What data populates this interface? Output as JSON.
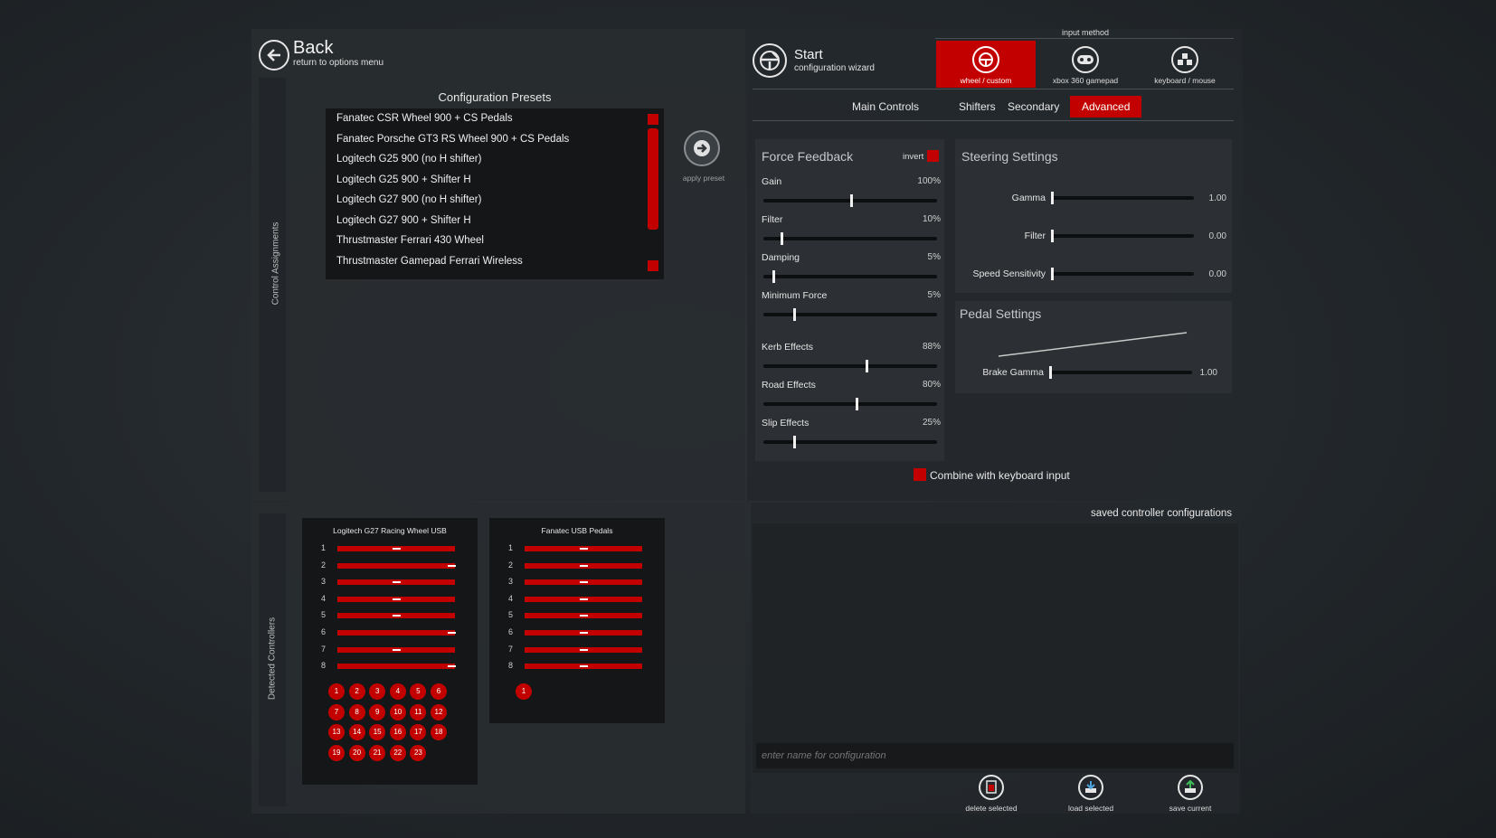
{
  "header": {
    "back_title": "Back",
    "back_subtitle": "return to options menu",
    "start_title": "Start",
    "start_subtitle": "configuration wizard"
  },
  "side_labels": {
    "control_assignments": "Control Assignments",
    "detected_controllers": "Detected Controllers"
  },
  "presets": {
    "title": "Configuration Presets",
    "apply_label": "apply preset",
    "items": [
      "Fanatec CSR Wheel 900 + CS Pedals",
      "Fanatec Porsche GT3 RS Wheel 900 + CS Pedals",
      "Logitech G25 900 (no H shifter)",
      "Logitech G25 900 + Shifter H",
      "Logitech G27 900 (no H shifter)",
      "Logitech G27 900 + Shifter H",
      "Thrustmaster Ferrari 430 Wheel",
      "Thrustmaster Gamepad Ferrari Wireless"
    ]
  },
  "input_method": {
    "title": "input method",
    "options": [
      "wheel / custom",
      "xbox 360 gamepad",
      "keyboard / mouse"
    ],
    "selected": "wheel / custom"
  },
  "tabs": [
    "Main Controls",
    "Shifters",
    "Secondary",
    "Advanced"
  ],
  "active_tab": "Advanced",
  "force_feedback": {
    "title": "Force Feedback",
    "invert_label": "invert",
    "sliders": [
      {
        "label": "Gain",
        "value": "100%",
        "level": 0.5
      },
      {
        "label": "Filter",
        "value": "10%",
        "level": 0.1
      },
      {
        "label": "Damping",
        "value": "5%",
        "level": 0.05
      },
      {
        "label": "Minimum Force",
        "value": "5%",
        "level": 0.17
      },
      {
        "label": "Kerb Effects",
        "value": "88%",
        "level": 0.59
      },
      {
        "label": "Road Effects",
        "value": "80%",
        "level": 0.53
      },
      {
        "label": "Slip Effects",
        "value": "25%",
        "level": 0.17
      }
    ]
  },
  "steering": {
    "title": "Steering Settings",
    "sliders": [
      {
        "label": "Gamma",
        "value": "1.00",
        "level": 0.0
      },
      {
        "label": "Filter",
        "value": "0.00",
        "level": 0.0
      },
      {
        "label": "Speed Sensitivity",
        "value": "0.00",
        "level": 0.0
      }
    ]
  },
  "pedal": {
    "title": "Pedal Settings",
    "slider": {
      "label": "Brake Gamma",
      "value": "1.00",
      "level": 0.0
    }
  },
  "combine_label": "Combine with keyboard input",
  "controllers": [
    {
      "name": "Logitech G27 Racing Wheel USB",
      "axes": [
        {
          "n": "1",
          "level": 0.5
        },
        {
          "n": "2",
          "level": 0.97
        },
        {
          "n": "3",
          "level": 0.5
        },
        {
          "n": "4",
          "level": 0.5
        },
        {
          "n": "5",
          "level": 0.5
        },
        {
          "n": "6",
          "level": 0.97
        },
        {
          "n": "7",
          "level": 0.5
        },
        {
          "n": "8",
          "level": 0.97
        }
      ],
      "buttons": [
        "1",
        "2",
        "3",
        "4",
        "5",
        "6",
        "7",
        "8",
        "9",
        "10",
        "11",
        "12",
        "13",
        "14",
        "15",
        "16",
        "17",
        "18",
        "19",
        "20",
        "21",
        "22",
        "23"
      ]
    },
    {
      "name": "Fanatec USB Pedals",
      "axes": [
        {
          "n": "1",
          "level": 0.5
        },
        {
          "n": "2",
          "level": 0.5
        },
        {
          "n": "3",
          "level": 0.5
        },
        {
          "n": "4",
          "level": 0.5
        },
        {
          "n": "5",
          "level": 0.5
        },
        {
          "n": "6",
          "level": 0.5
        },
        {
          "n": "7",
          "level": 0.5
        },
        {
          "n": "8",
          "level": 0.5
        }
      ],
      "buttons": [
        "1"
      ]
    }
  ],
  "saved": {
    "title": "saved controller configurations",
    "name_placeholder": "enter name for configuration",
    "actions": [
      "delete selected",
      "load selected",
      "save current"
    ]
  },
  "colors": {
    "accent": "#c30000",
    "panel": "#282c30",
    "list_bg": "#141618"
  }
}
